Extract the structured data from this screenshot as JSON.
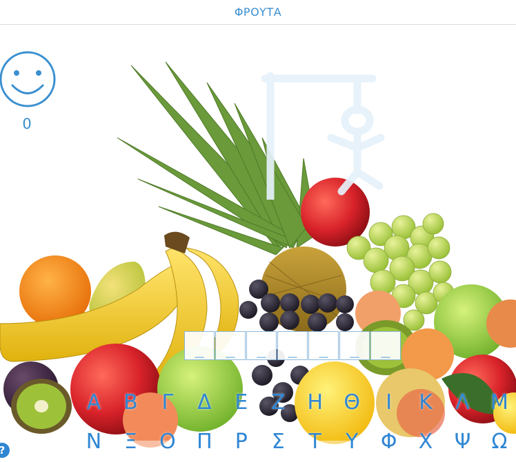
{
  "header": {
    "title": "ΦΡΟΥΤΑ"
  },
  "score": {
    "value": "0"
  },
  "word": {
    "slots": [
      "_",
      "_",
      "_",
      "_",
      "_",
      "_",
      "_"
    ]
  },
  "keyboard": {
    "row1": [
      "Α",
      "Β",
      "Γ",
      "Δ",
      "Ε",
      "Ζ",
      "Η",
      "Θ",
      "Ι",
      "Κ",
      "Λ",
      "Μ"
    ],
    "row2": [
      "Ν",
      "Ξ",
      "Ο",
      "Π",
      "Ρ",
      "Σ",
      "Τ",
      "Υ",
      "Φ",
      "Χ",
      "Ψ",
      "Ω"
    ]
  },
  "help": {
    "label": "?"
  },
  "colors": {
    "accent": "#3a8fd0",
    "key": "#2f86d3",
    "gallows": "#e6f1fa"
  },
  "icons": [
    "smiley-face-icon",
    "help-icon"
  ]
}
